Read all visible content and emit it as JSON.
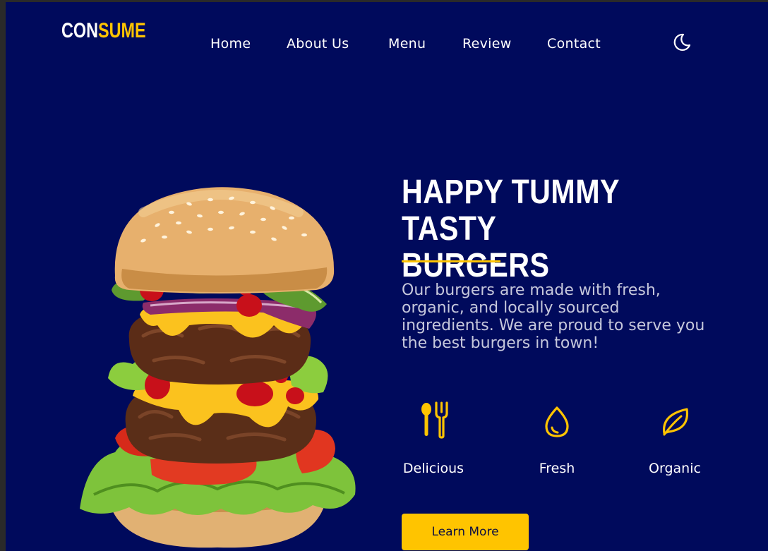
{
  "brand": {
    "part1": "CON",
    "part2": "SUME",
    "color1": "#ffffff",
    "color2": "#ffc400"
  },
  "nav": {
    "items": [
      {
        "label": "Home"
      },
      {
        "label": "About Us"
      },
      {
        "label": "Menu"
      },
      {
        "label": "Review"
      },
      {
        "label": "Contact"
      }
    ],
    "theme_toggle_icon": "moon-icon"
  },
  "hero": {
    "title_line1": "HAPPY TUMMY TASTY",
    "title_line2": "BURGERS",
    "description": "Our burgers are made with fresh, organic, and locally sourced ingredients. We are proud to serve you the best burgers in town!",
    "features": [
      {
        "icon": "utensils-icon",
        "label": "Delicious"
      },
      {
        "icon": "droplet-icon",
        "label": "Fresh"
      },
      {
        "icon": "leaf-icon",
        "label": "Organic"
      }
    ],
    "cta_label": "Learn More"
  },
  "colors": {
    "background": "#000a5c",
    "accent": "#ffc400",
    "text": "#ffffff"
  }
}
